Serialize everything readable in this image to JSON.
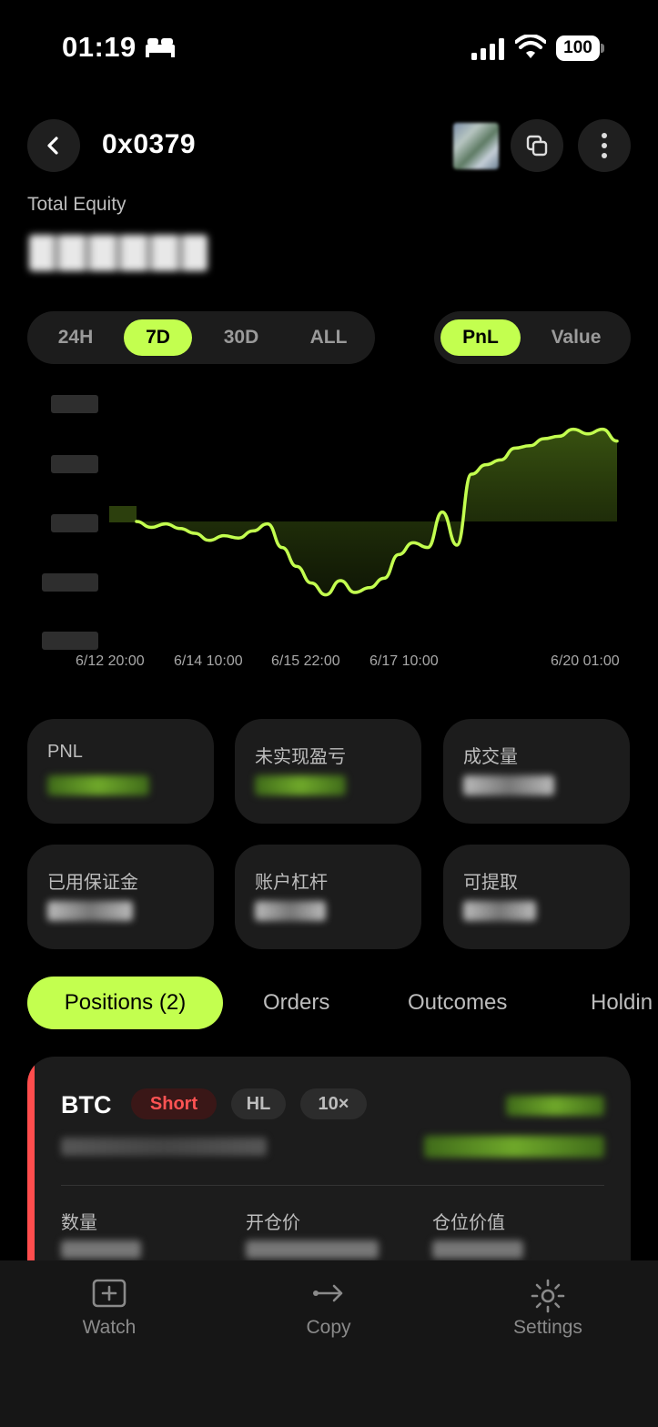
{
  "status_bar": {
    "time": "01:19",
    "battery": "100"
  },
  "header": {
    "title": "0x0379"
  },
  "equity": {
    "label": "Total Equity"
  },
  "range_tabs": [
    "24H",
    "7D",
    "30D",
    "ALL"
  ],
  "range_selected": "7D",
  "mode_tabs": [
    "PnL",
    "Value"
  ],
  "mode_selected": "PnL",
  "colors": {
    "accent": "#c3ff4f",
    "short": "#ff4d4d",
    "background": "#000000",
    "card": "#1c1c1c"
  },
  "chart_data": {
    "type": "area",
    "x_tick_labels": [
      "6/12 20:00",
      "6/14 10:00",
      "6/15 22:00",
      "6/17 10:00",
      "6/20 01:00"
    ],
    "y_tick_labels_obscured": true,
    "baseline_relative_values": [
      0.0,
      -0.05,
      -0.02,
      -0.06,
      -0.1,
      -0.16,
      -0.12,
      -0.14,
      -0.08,
      -0.02,
      -0.22,
      -0.38,
      -0.52,
      -0.62,
      -0.5,
      -0.6,
      -0.56,
      -0.48,
      -0.28,
      -0.18,
      -0.22,
      0.08,
      -0.2,
      0.4,
      0.48,
      0.52,
      0.62,
      0.64,
      0.7,
      0.72,
      0.78,
      0.74,
      0.78,
      0.68
    ],
    "line_color": "#c3ff4f"
  },
  "stats": [
    {
      "label": "PNL"
    },
    {
      "label": "未实现盈亏"
    },
    {
      "label": "成交量"
    },
    {
      "label": "已用保证金"
    },
    {
      "label": "账户杠杆"
    },
    {
      "label": "可提取"
    }
  ],
  "tabs": [
    "Positions (2)",
    "Orders",
    "Outcomes",
    "Holdin"
  ],
  "tab_selected": "Positions (2)",
  "position": {
    "symbol": "BTC",
    "side": "Short",
    "venue": "HL",
    "leverage": "10×",
    "field_labels": [
      "数量",
      "开仓价",
      "仓位价值"
    ]
  },
  "bottom_nav": [
    {
      "label": "Watch",
      "icon": "plus-square-icon"
    },
    {
      "label": "Copy",
      "icon": "arrow-right-icon"
    },
    {
      "label": "Settings",
      "icon": "gear-icon"
    }
  ]
}
